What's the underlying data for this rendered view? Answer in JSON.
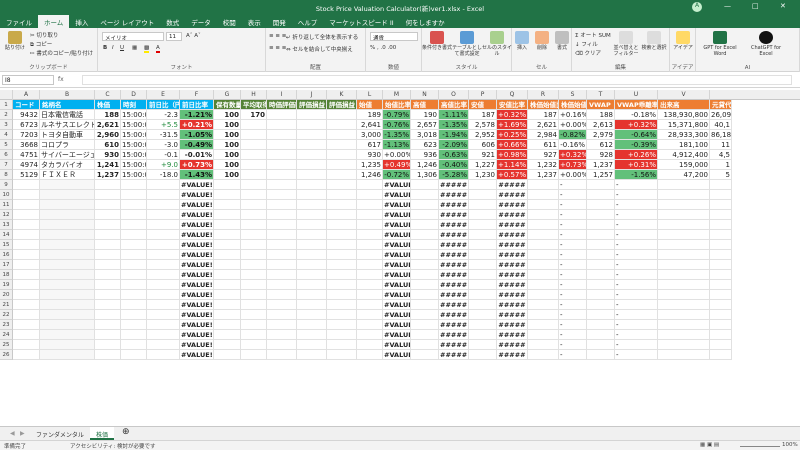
{
  "window": {
    "title": "Stock Price Valuation Calculator(新)ver1.xlsx - Excel",
    "user_initial": "A"
  },
  "menu": {
    "tabs": [
      "ファイル",
      "ホーム",
      "挿入",
      "ページ レイアウト",
      "数式",
      "データ",
      "校閲",
      "表示",
      "開発",
      "ヘルプ",
      "マーケットスピード II"
    ],
    "active": "ホーム",
    "search": "何をしますか"
  },
  "ribbon": {
    "paste": "貼り付け",
    "cut": "切り取り",
    "copy": "コピー",
    "format_painter": "書式のコピー/貼り付け",
    "clipboard_label": "クリップボード",
    "font_name": "メイリオ",
    "font_size": "11",
    "font_label": "フォント",
    "wrap_text": "折り返して全体を表示する",
    "merge_center": "セルを結合して中央揃え",
    "alignment_label": "配置",
    "number_format": "通貨",
    "number_label": "数値",
    "cond_format": "条件付き書式",
    "table_format": "テーブルとして書式設定",
    "cell_styles": "セルのスタイル",
    "styles_label": "スタイル",
    "insert": "挿入",
    "delete": "削除",
    "format": "書式",
    "cells_label": "セル",
    "autosum": "オート SUM",
    "fill": "フィル",
    "clear": "クリア",
    "sort_filter": "並べ替えとフィルター",
    "find_select": "検索と選択",
    "editing_label": "編集",
    "ideas": "アイデア",
    "ideas_label": "アイデア",
    "gpt_word": "GPT for Excel Word",
    "gpt_excel": "ChatGPT for Excel",
    "gptforwork": "gptforwork.com",
    "ai_label": "AI"
  },
  "formula_bar": {
    "name_box": "I8",
    "fx": "fx",
    "value": ""
  },
  "columns": [
    "A",
    "B",
    "C",
    "D",
    "E",
    "F",
    "G",
    "H",
    "I",
    "J",
    "K",
    "L",
    "M",
    "N",
    "O",
    "P",
    "Q",
    "R",
    "S",
    "T",
    "U",
    "V"
  ],
  "headers": [
    "コード",
    "銘柄名",
    "株価",
    "時刻",
    "前日比（円）",
    "前日比率",
    "保有数量",
    "平均取得",
    "時価評価額",
    "評価損益",
    "評価損益",
    "始値",
    "始値比率",
    "高値",
    "高値比率",
    "安値",
    "安値比率",
    "株価始値比",
    "株価始値比率",
    "VWAP",
    "VWAP乖離率",
    "出来高",
    "元貸代金"
  ],
  "rows": [
    [
      "9432",
      "日本電信電話",
      "188",
      "15:00:0",
      "-2.3",
      "-1.21%",
      "100",
      "170",
      "",
      "",
      "",
      "189",
      "-0.79%",
      "190",
      "-1.11%",
      "187",
      "+0.32%",
      "187",
      "+0.16%",
      "188",
      "-0.18%",
      "138,930,800",
      "26,09"
    ],
    [
      "6723",
      "ルネサスエレクトロニ",
      "2,621",
      "15:00:0",
      "+5.5",
      "+0.21%",
      "100",
      "",
      "",
      "",
      "",
      "2,641",
      "-0.76%",
      "2,657",
      "-1.35%",
      "2,578",
      "+1.69%",
      "2,621",
      "+0.00%",
      "2,613",
      "+0.32%",
      "15,371,800",
      "40,1"
    ],
    [
      "7203",
      "トヨタ自動車",
      "2,960",
      "15:00:0",
      "-31.5",
      "-1.05%",
      "100",
      "",
      "",
      "",
      "",
      "3,000",
      "-1.35%",
      "3,018",
      "-1.94%",
      "2,952",
      "+0.25%",
      "2,984",
      "-0.82%",
      "2,979",
      "-0.64%",
      "28,933,300",
      "86,18"
    ],
    [
      "3668",
      "コロプラ",
      "610",
      "15:00:0",
      "-3.0",
      "-0.49%",
      "100",
      "",
      "",
      "",
      "",
      "617",
      "-1.13%",
      "623",
      "-2.09%",
      "606",
      "+0.66%",
      "611",
      "-0.16%",
      "612",
      "-0.39%",
      "181,100",
      "11"
    ],
    [
      "4751",
      "サイバーエージェント",
      "930",
      "15:00:0",
      "-0.1",
      "-0.01%",
      "100",
      "",
      "",
      "",
      "",
      "930",
      "+0.00%",
      "936",
      "-0.63%",
      "921",
      "+0.98%",
      "927",
      "+0.32%",
      "928",
      "+0.26%",
      "4,912,400",
      "4,5"
    ],
    [
      "4974",
      "タカラバイオ",
      "1,241",
      "15:00:0",
      "+9.0",
      "+0.73%",
      "100",
      "",
      "",
      "",
      "",
      "1,235",
      "+0.49%",
      "1,246",
      "-0.40%",
      "1,227",
      "+1.14%",
      "1,232",
      "+0.73%",
      "1,237",
      "+0.31%",
      "159,000",
      "1"
    ],
    [
      "5129",
      "ＦＩＸＥＲ",
      "1,237",
      "15:00:0",
      "-18.0",
      "-1.43%",
      "100",
      "",
      "",
      "",
      "",
      "1,246",
      "-0.72%",
      "1,306",
      "-5.28%",
      "1,230",
      "+0.57%",
      "1,237",
      "+0.00%",
      "1,257",
      "-1.56%",
      "47,200",
      "5"
    ]
  ],
  "error_text": "#VALUE!",
  "hash_text": "#####",
  "dash_text": "-",
  "sheet_tabs": [
    "ファンダメンタル",
    "株価"
  ],
  "active_sheet": "株価",
  "status": {
    "mode": "準備完了",
    "accessibility": "アクセシビリティ: 検討が必要です",
    "zoom": "100%"
  }
}
